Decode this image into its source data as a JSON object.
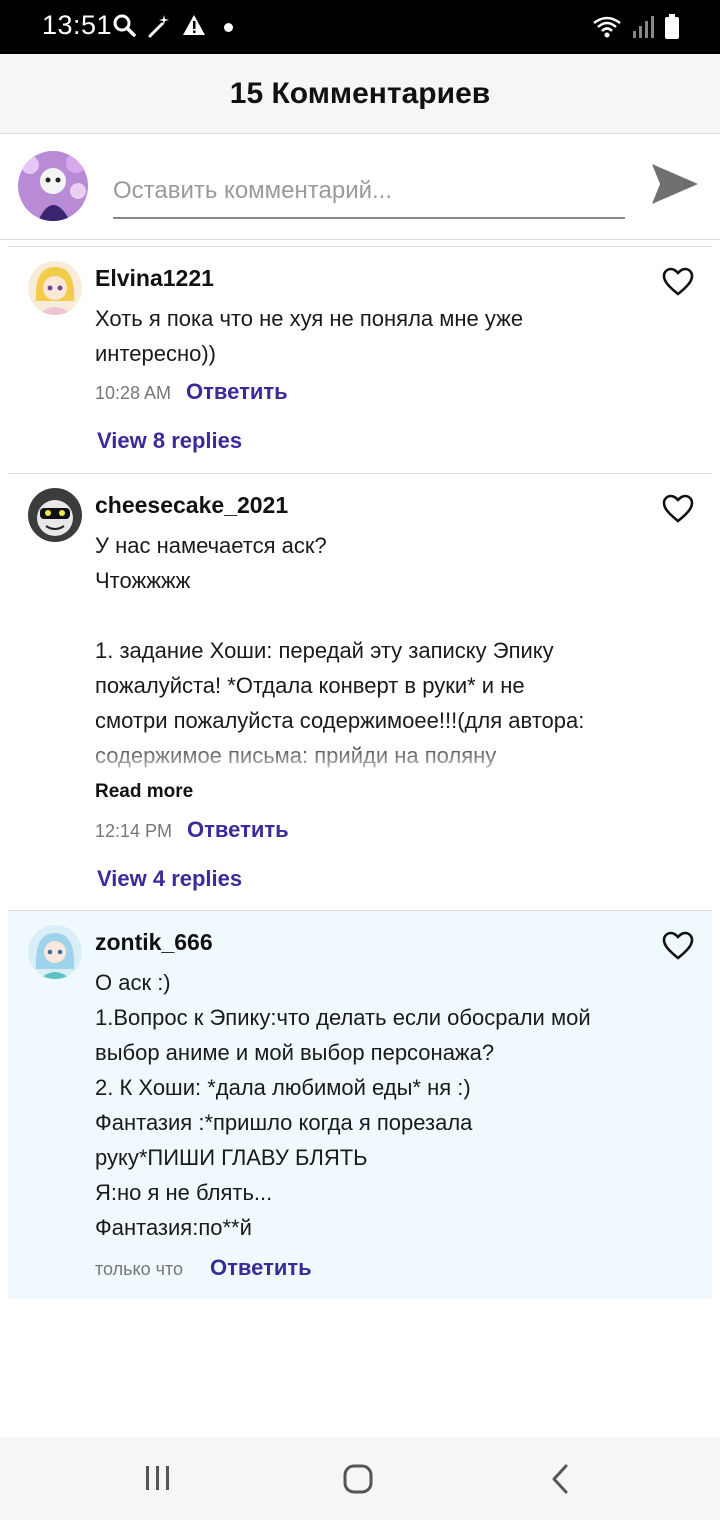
{
  "status_bar": {
    "time": "13:51"
  },
  "header": {
    "title": "15 Комментариев"
  },
  "compose": {
    "placeholder": "Оставить комментарий..."
  },
  "comments": [
    {
      "username": "Elvina1221",
      "text": "Хоть я пока что не хуя не поняла мне уже\nинтересно))",
      "time": "10:28 AM",
      "reply_label": "Ответить",
      "view_replies": "View 8 replies"
    },
    {
      "username": "cheesecake_2021",
      "text": "У нас намечается аск?\nЧтожжжж\n\n1. задание Хоши: передай эту записку Эпику\nпожалуйста! *Отдала конверт в руки* и не\nсмотри пожалуйста содержимоее!!!(для автора:\nсодержимое письма: прийди на поляну",
      "read_more": "Read more",
      "time": "12:14 PM",
      "reply_label": "Ответить",
      "view_replies": "View 4 replies"
    },
    {
      "username": "zontik_666",
      "text": "О аск :)\n1.Вопрос к Эпику:что делать если обосрали мой\nвыбор аниме и мой выбор персонажа?\n2. К Хоши: *дала любимой еды* ня :)\nФантазия :*пришло когда я порезала\nруку*ПИШИ ГЛАВУ БЛЯТЬ\nЯ:но я не блять...\nФантазия:по**й",
      "time": "только что",
      "reply_label": "Ответить"
    }
  ],
  "icons": {
    "search": "search-icon",
    "wand": "magic-wand-icon",
    "alert": "alert-icon",
    "wifi": "wifi-icon",
    "signal": "signal-icon",
    "battery": "battery-icon",
    "send": "send-icon",
    "heart": "heart-icon",
    "recents": "recents-icon",
    "home": "home-icon",
    "back": "back-icon"
  },
  "colors": {
    "accent": "#3a2b9b",
    "highlight_bg": "#f0f9fd",
    "status_bar": "#000000"
  }
}
